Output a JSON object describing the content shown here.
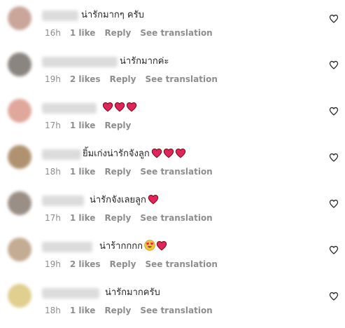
{
  "colors": {
    "meta_text": "#8e8e8e",
    "comment_text": "#262626",
    "heart_red": "#e0245e"
  },
  "comments": [
    {
      "text": "น่ารักมากๆ ครับ",
      "emojis": [],
      "time": "16h",
      "likes": "1 like",
      "reply": "Reply",
      "see_translation": "See translation",
      "avatar_color": "#c9a59a",
      "name_blur_width": 52
    },
    {
      "text": "น่ารักมากค่ะ",
      "emojis": [],
      "time": "19h",
      "likes": "2 likes",
      "reply": "Reply",
      "see_translation": "See translation",
      "avatar_color": "#8a8580",
      "name_blur_width": 108
    },
    {
      "text": "",
      "emojis": [
        "red-heart",
        "red-heart",
        "red-heart"
      ],
      "time": "17h",
      "likes": "1 like",
      "reply": "Reply",
      "see_translation": "",
      "avatar_color": "#e0a79c",
      "name_blur_width": 78
    },
    {
      "text": "ยิ้มเก่งน่ารักจังลูก",
      "emojis": [
        "red-heart",
        "red-heart",
        "red-heart"
      ],
      "time": "18h",
      "likes": "1 like",
      "reply": "Reply",
      "see_translation": "See translation",
      "avatar_color": "#b09270",
      "name_blur_width": 56
    },
    {
      "text": "น่ารักจังเลยลูก",
      "emojis": [
        "red-heart"
      ],
      "time": "17h",
      "likes": "1 like",
      "reply": "Reply",
      "see_translation": "See translation",
      "avatar_color": "#9a8f86",
      "name_blur_width": 60
    },
    {
      "text": "น่าร้ากกกก",
      "emojis": [
        "heart-eyes-face",
        "red-heart"
      ],
      "time": "19h",
      "likes": "2 likes",
      "reply": "Reply",
      "see_translation": "See translation",
      "avatar_color": "#c4ab93",
      "name_blur_width": 72
    },
    {
      "text": "น่ารักมากครับ",
      "emojis": [],
      "time": "18h",
      "likes": "1 like",
      "reply": "Reply",
      "see_translation": "See translation",
      "avatar_color": "#e0cf8f",
      "name_blur_width": 82
    }
  ]
}
